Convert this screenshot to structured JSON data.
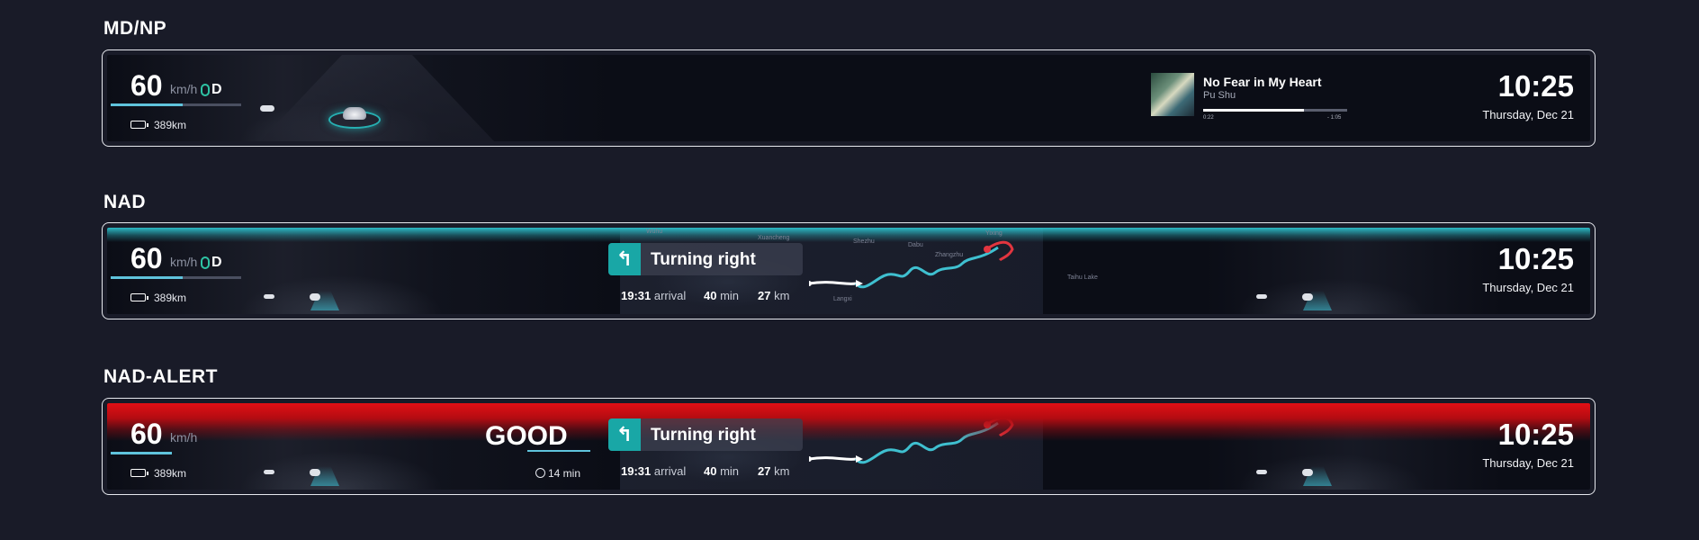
{
  "sections": {
    "mdnp": "MD/NP",
    "nad": "NAD",
    "nad_alert": "NAD-ALERT"
  },
  "common": {
    "speed": "60",
    "speed_unit": "km/h",
    "gear": "D",
    "range": "389km",
    "clock": "10:25",
    "date": "Thursday, Dec 21",
    "speed_fraction": 0.55
  },
  "media": {
    "title": "No Fear in My Heart",
    "artist": "Pu Shu",
    "elapsed": "0:22",
    "remaining": "- 1:05",
    "progress_fraction": 0.7
  },
  "navigation": {
    "instruction": "Turning right",
    "arrival_time": "19:31",
    "arrival_label": "arrival",
    "duration_value": "40",
    "duration_unit": "min",
    "distance_value": "27",
    "distance_unit": "km",
    "map_labels": [
      "Wuhu",
      "Xuancheng",
      "Shezhu",
      "Dabu",
      "Zhangzhu",
      "Yixing",
      "Langxi",
      "Taihu Lake"
    ]
  },
  "alert": {
    "status": "GOOD",
    "timer": "14 min"
  },
  "colors": {
    "teal_accent": "#19a7a6",
    "nad_glow": "#2bb8c4",
    "alert_red": "#e30f14",
    "route": "#3fc0d0",
    "destination": "#e2353f"
  }
}
